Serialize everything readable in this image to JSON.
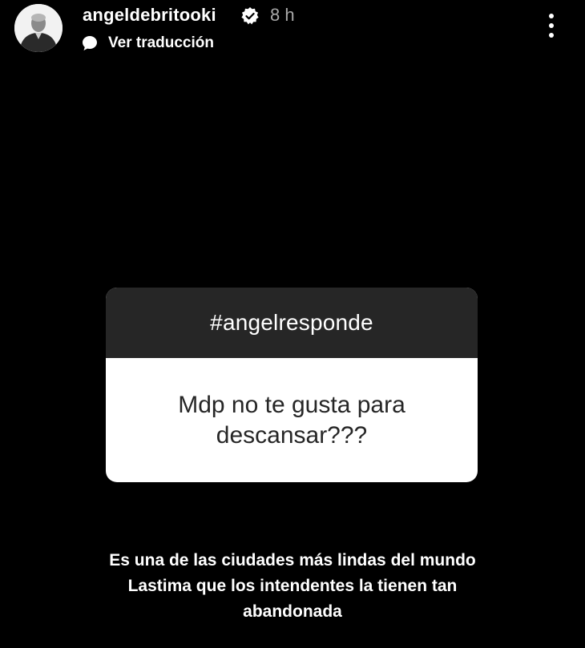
{
  "header": {
    "username": "angeldebritooki",
    "verified": true,
    "timestamp": "8 h",
    "translate_label": "Ver traducción",
    "avatar_icon": "profile-avatar",
    "menu_icon": "more-vertical-icon"
  },
  "question_card": {
    "header_text": "#angelresponde",
    "question_text": "Mdp no te gusta para\ndescansar???"
  },
  "caption": {
    "text": "Es una de las ciudades más lindas del mundo\nLastima que los intendentes la tienen tan\nabandonada"
  },
  "colors": {
    "background": "#000000",
    "card_header": "#262626",
    "card_body": "#ffffff",
    "timestamp": "#a8a8a8"
  }
}
